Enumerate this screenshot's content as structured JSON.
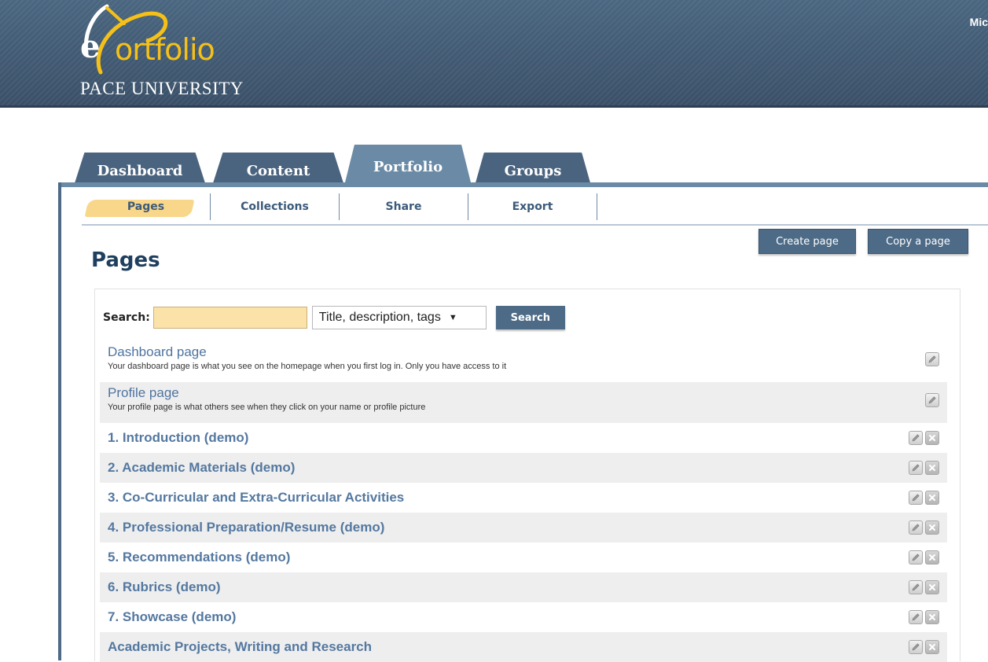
{
  "header": {
    "logo_e": "e",
    "logo_word": "ortfolio",
    "logo_subtitle": "PACE UNIVERSITY",
    "user_name": "Mic"
  },
  "tabs": [
    {
      "label": "Dashboard",
      "active": false
    },
    {
      "label": "Content",
      "active": false
    },
    {
      "label": "Portfolio",
      "active": true
    },
    {
      "label": "Groups",
      "active": false
    }
  ],
  "subnav": [
    {
      "label": "Pages",
      "active": true
    },
    {
      "label": "Collections",
      "active": false
    },
    {
      "label": "Share",
      "active": false
    },
    {
      "label": "Export",
      "active": false
    }
  ],
  "page": {
    "title": "Pages",
    "create_label": "Create page",
    "copy_label": "Copy a page"
  },
  "search": {
    "label": "Search:",
    "value": "",
    "option_selected": "Title, description, tags",
    "button_label": "Search"
  },
  "rows": [
    {
      "title": "Dashboard page",
      "desc": "Your dashboard page is what you see on the homepage when you first log in. Only you have access to it",
      "delete": false
    },
    {
      "title": "Profile page",
      "desc": "Your profile page is what others see when they click on your name or profile picture",
      "delete": false
    },
    {
      "title": "1. Introduction (demo)",
      "desc": "",
      "delete": true
    },
    {
      "title": "2. Academic Materials (demo)",
      "desc": "",
      "delete": true
    },
    {
      "title": "3. Co-Curricular and Extra-Curricular Activities",
      "desc": "",
      "delete": true
    },
    {
      "title": "4. Professional Preparation/Resume (demo)",
      "desc": "",
      "delete": true
    },
    {
      "title": "5. Recommendations (demo)",
      "desc": "",
      "delete": true
    },
    {
      "title": "6. Rubrics (demo)",
      "desc": "",
      "delete": true
    },
    {
      "title": "7. Showcase (demo)",
      "desc": "",
      "delete": true
    },
    {
      "title": "Academic Projects, Writing and Research",
      "desc": "",
      "delete": true
    }
  ],
  "colors": {
    "header": "#3f566f",
    "tab": "#4a6480",
    "tab_active": "#6a8aa6",
    "logo_accent": "#f5c018",
    "link": "#5478a0",
    "button": "#4d6a86",
    "search_field": "#fbe2a8"
  }
}
